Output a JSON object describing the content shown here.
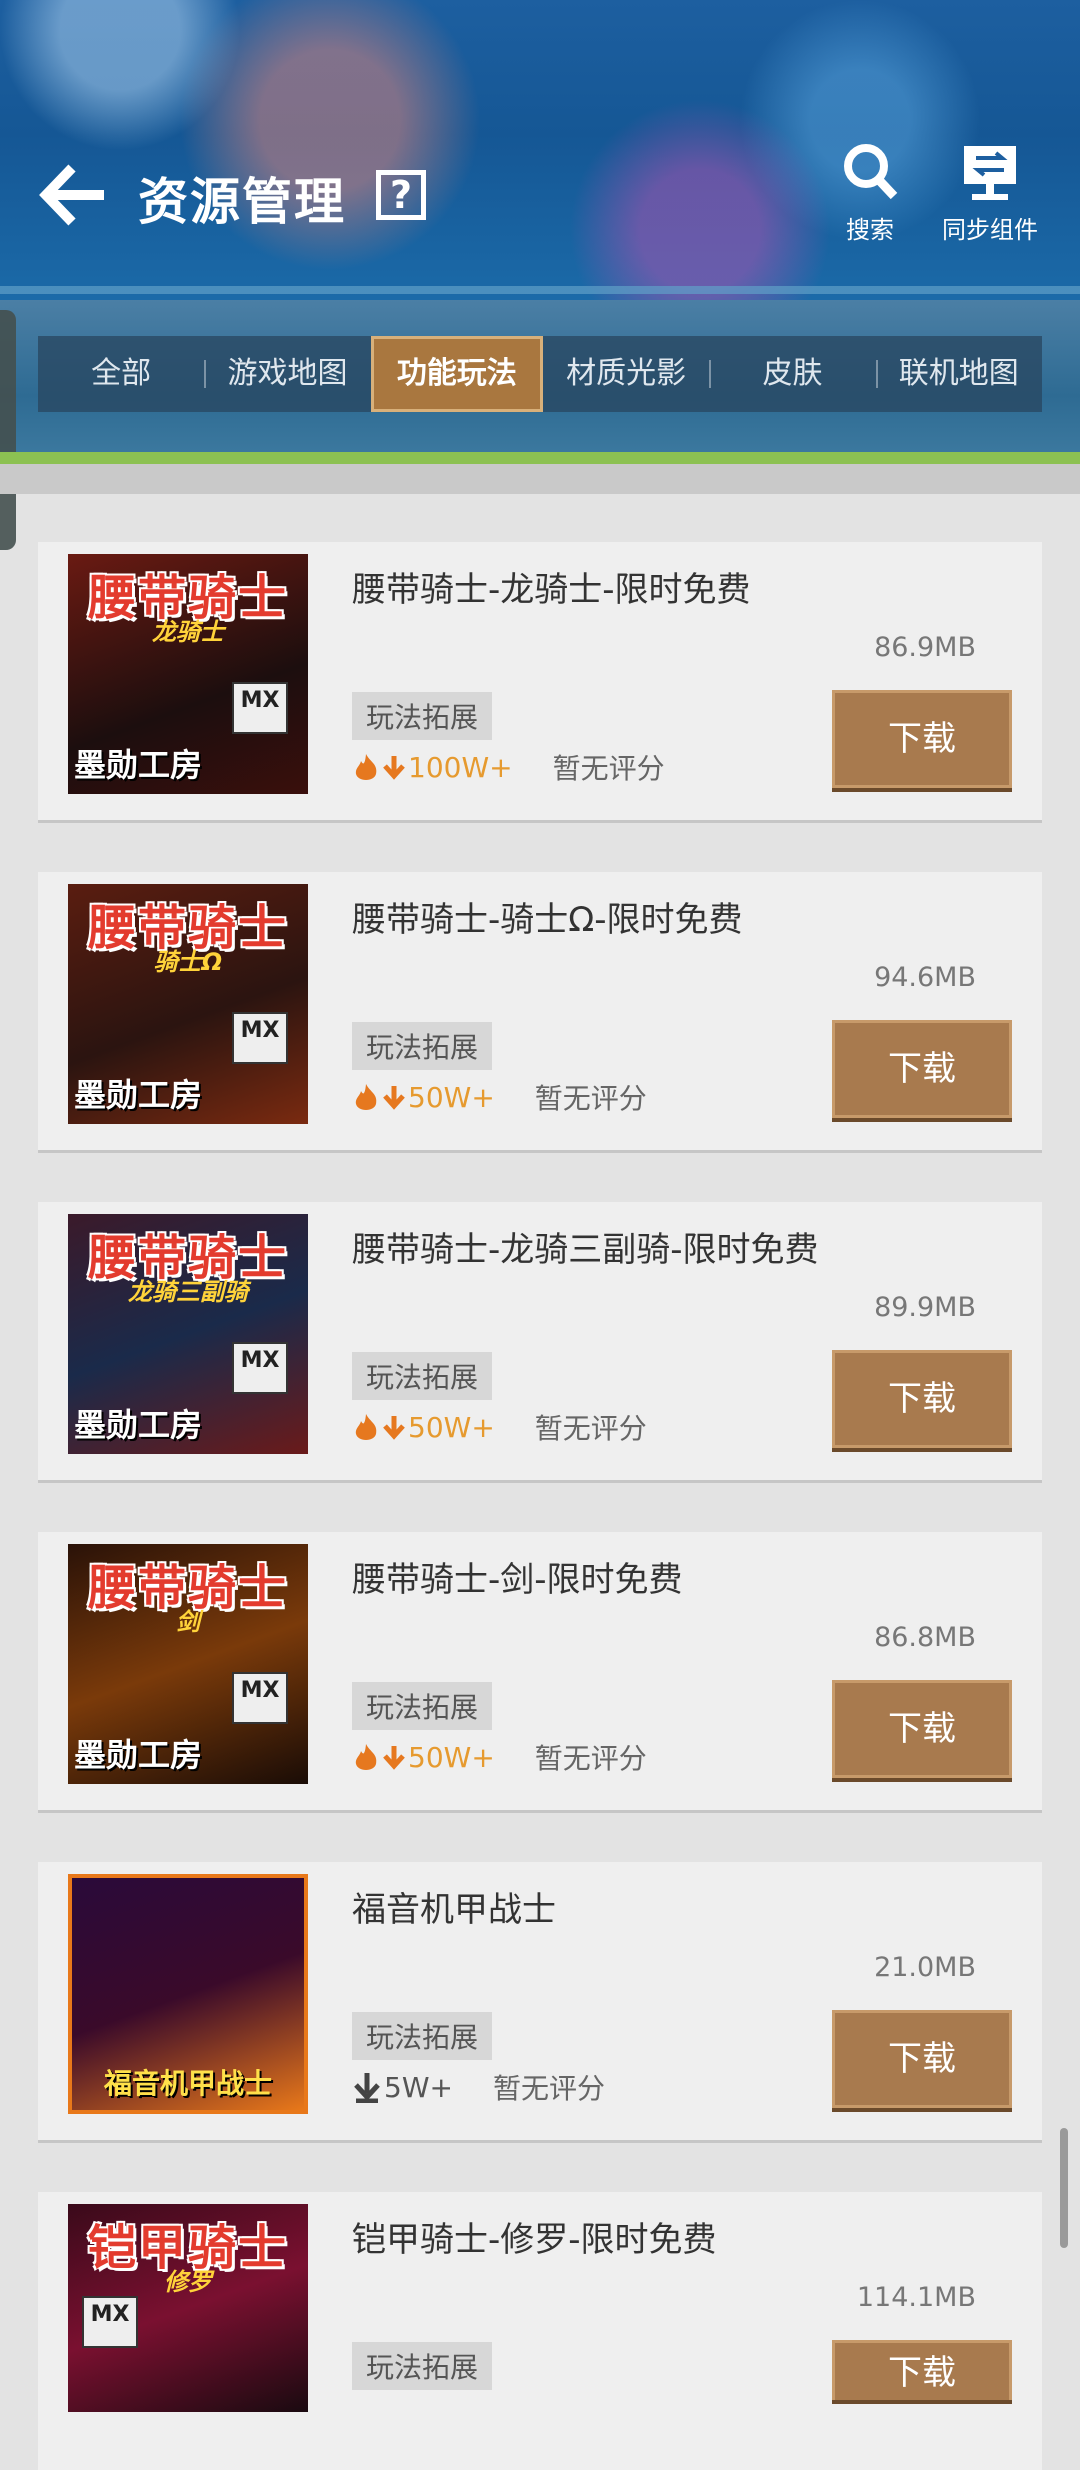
{
  "header": {
    "title": "资源管理",
    "help_label": "?",
    "search_label": "搜索",
    "sync_label": "同步组件"
  },
  "tabs": [
    {
      "label": "全部"
    },
    {
      "label": "游戏地图"
    },
    {
      "label": "功能玩法"
    },
    {
      "label": "材质光影"
    },
    {
      "label": "皮肤"
    },
    {
      "label": "联机地图"
    }
  ],
  "active_tab": "功能玩法",
  "items": [
    {
      "title": "腰带骑士-龙骑士-限时免费",
      "size": "86.9MB",
      "tag": "玩法拓展",
      "downloads": "100W+",
      "rating": "暂无评分",
      "button": "下载",
      "thumb": {
        "title": "腰带骑士",
        "sub": "龙骑士",
        "logo": "墨勋工房",
        "mx": "MX"
      }
    },
    {
      "title": "腰带骑士-骑士Ω-限时免费",
      "size": "94.6MB",
      "tag": "玩法拓展",
      "downloads": "50W+",
      "rating": "暂无评分",
      "button": "下载",
      "thumb": {
        "title": "腰带骑士",
        "sub": "骑士Ω",
        "logo": "墨勋工房",
        "mx": "MX"
      }
    },
    {
      "title": "腰带骑士-龙骑三副骑-限时免费",
      "size": "89.9MB",
      "tag": "玩法拓展",
      "downloads": "50W+",
      "rating": "暂无评分",
      "button": "下载",
      "thumb": {
        "title": "腰带骑士",
        "sub": "龙骑三副骑",
        "logo": "墨勋工房",
        "mx": "MX"
      }
    },
    {
      "title": "腰带骑士-剑-限时免费",
      "size": "86.8MB",
      "tag": "玩法拓展",
      "downloads": "50W+",
      "rating": "暂无评分",
      "button": "下载",
      "thumb": {
        "title": "腰带骑士",
        "sub": "剑",
        "logo": "墨勋工房",
        "mx": "MX"
      }
    },
    {
      "title": "福音机甲战士",
      "size": "21.0MB",
      "tag": "玩法拓展",
      "downloads": "5W+",
      "rating": "暂无评分",
      "button": "下载",
      "thumb": {
        "title": "",
        "sub": "",
        "logo": "福音机甲战士",
        "mx": ""
      }
    },
    {
      "title": "铠甲骑士-修罗-限时免费",
      "size": "114.1MB",
      "tag": "玩法拓展",
      "downloads": "",
      "rating": "",
      "button": "下载",
      "thumb": {
        "title": "铠甲骑士",
        "sub": "修罗",
        "logo": "",
        "mx": "MX"
      }
    }
  ],
  "colors": {
    "accent_brown": "#a87a4e",
    "active_tab": "#a9773f",
    "downloads_orange": "#e69a2f",
    "green_bar": "#8cc152"
  }
}
